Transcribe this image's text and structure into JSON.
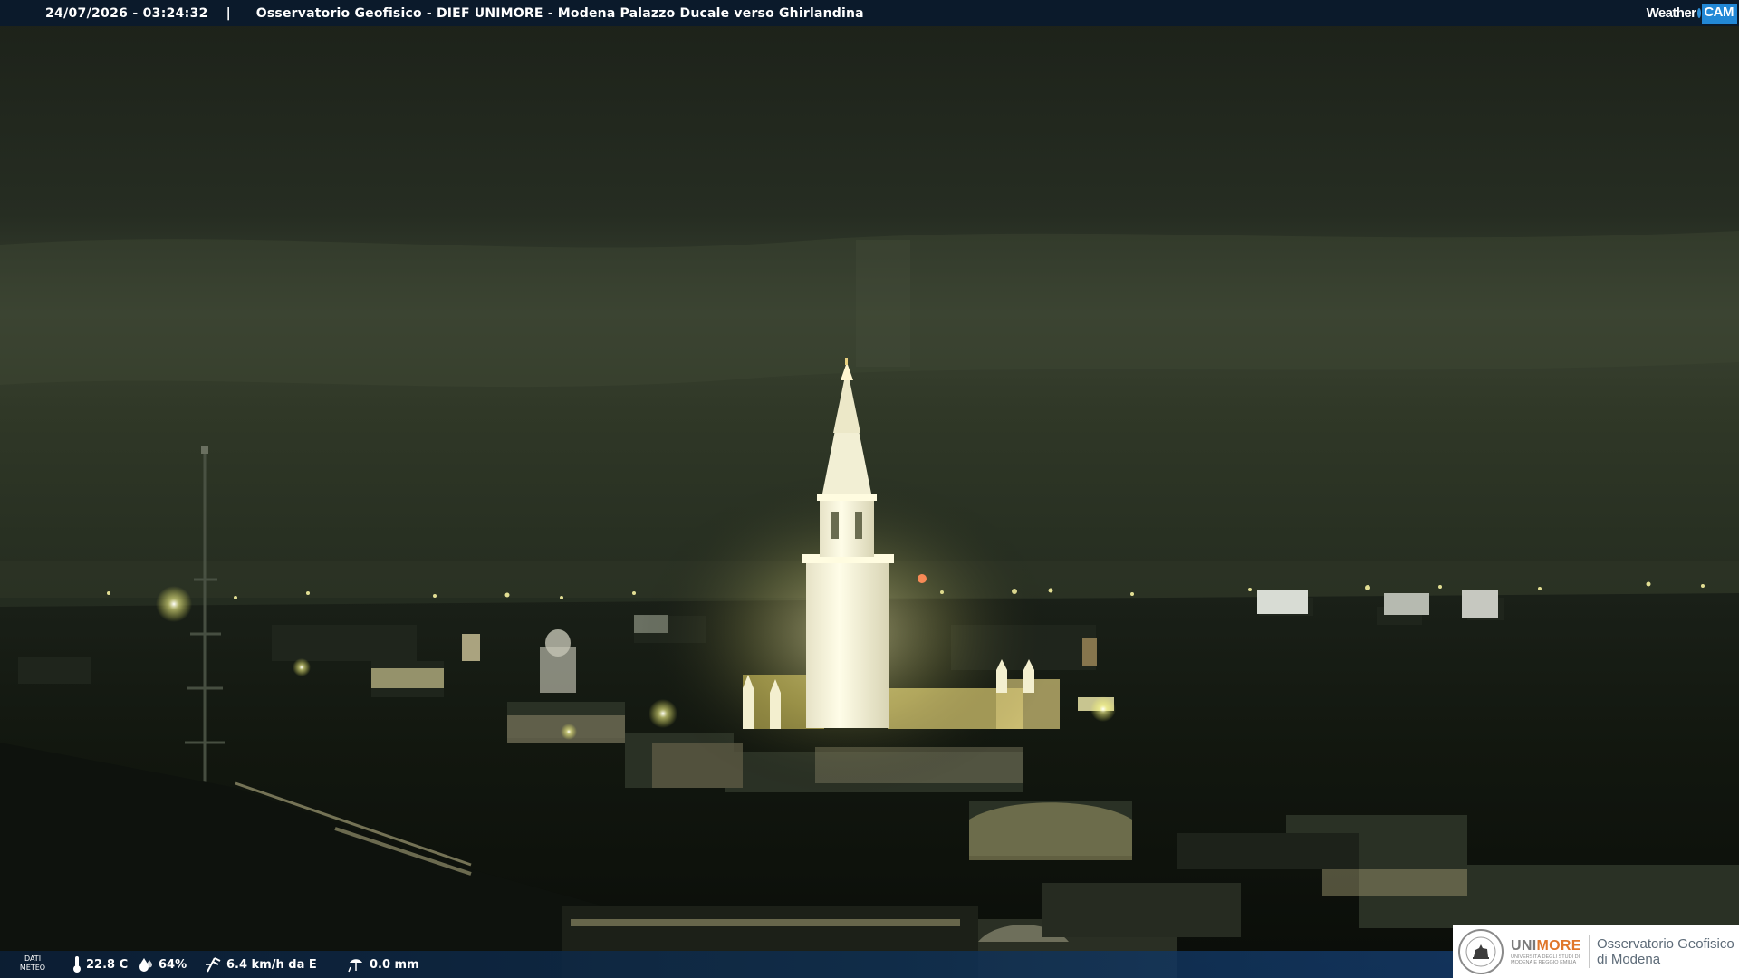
{
  "header": {
    "timestamp": "24/07/2026 - 03:24:32",
    "separator": "|",
    "title": "Osservatorio Geofisico - DIEF UNIMORE - Modena Palazzo Ducale verso Ghirlandina",
    "brand": {
      "word": "Weather",
      "badge": "CAM"
    }
  },
  "weather": {
    "label_line1": "DATI",
    "label_line2": "METEO",
    "temperature": "22.8 C",
    "humidity": "64%",
    "wind": "6.4 km/h da E",
    "rain": "0.0 mm"
  },
  "logo": {
    "name_part1": "UNI",
    "name_part2": "MORE",
    "subtitle": "UNIVERSITÀ DEGLI STUDI DI MODENA E REGGIO EMILIA",
    "observatory_line1": "Osservatorio Geofisico",
    "observatory_line2": "di Modena"
  },
  "colors": {
    "bar_background": "#0a1a2c",
    "brand_blue": "#2288d6",
    "unimore_orange": "#e0772a",
    "tower_light": "#fffbe6"
  },
  "icons": [
    "thermometer-icon",
    "humidity-drop-icon",
    "wind-icon",
    "rain-gauge-icon",
    "university-seal-icon"
  ]
}
